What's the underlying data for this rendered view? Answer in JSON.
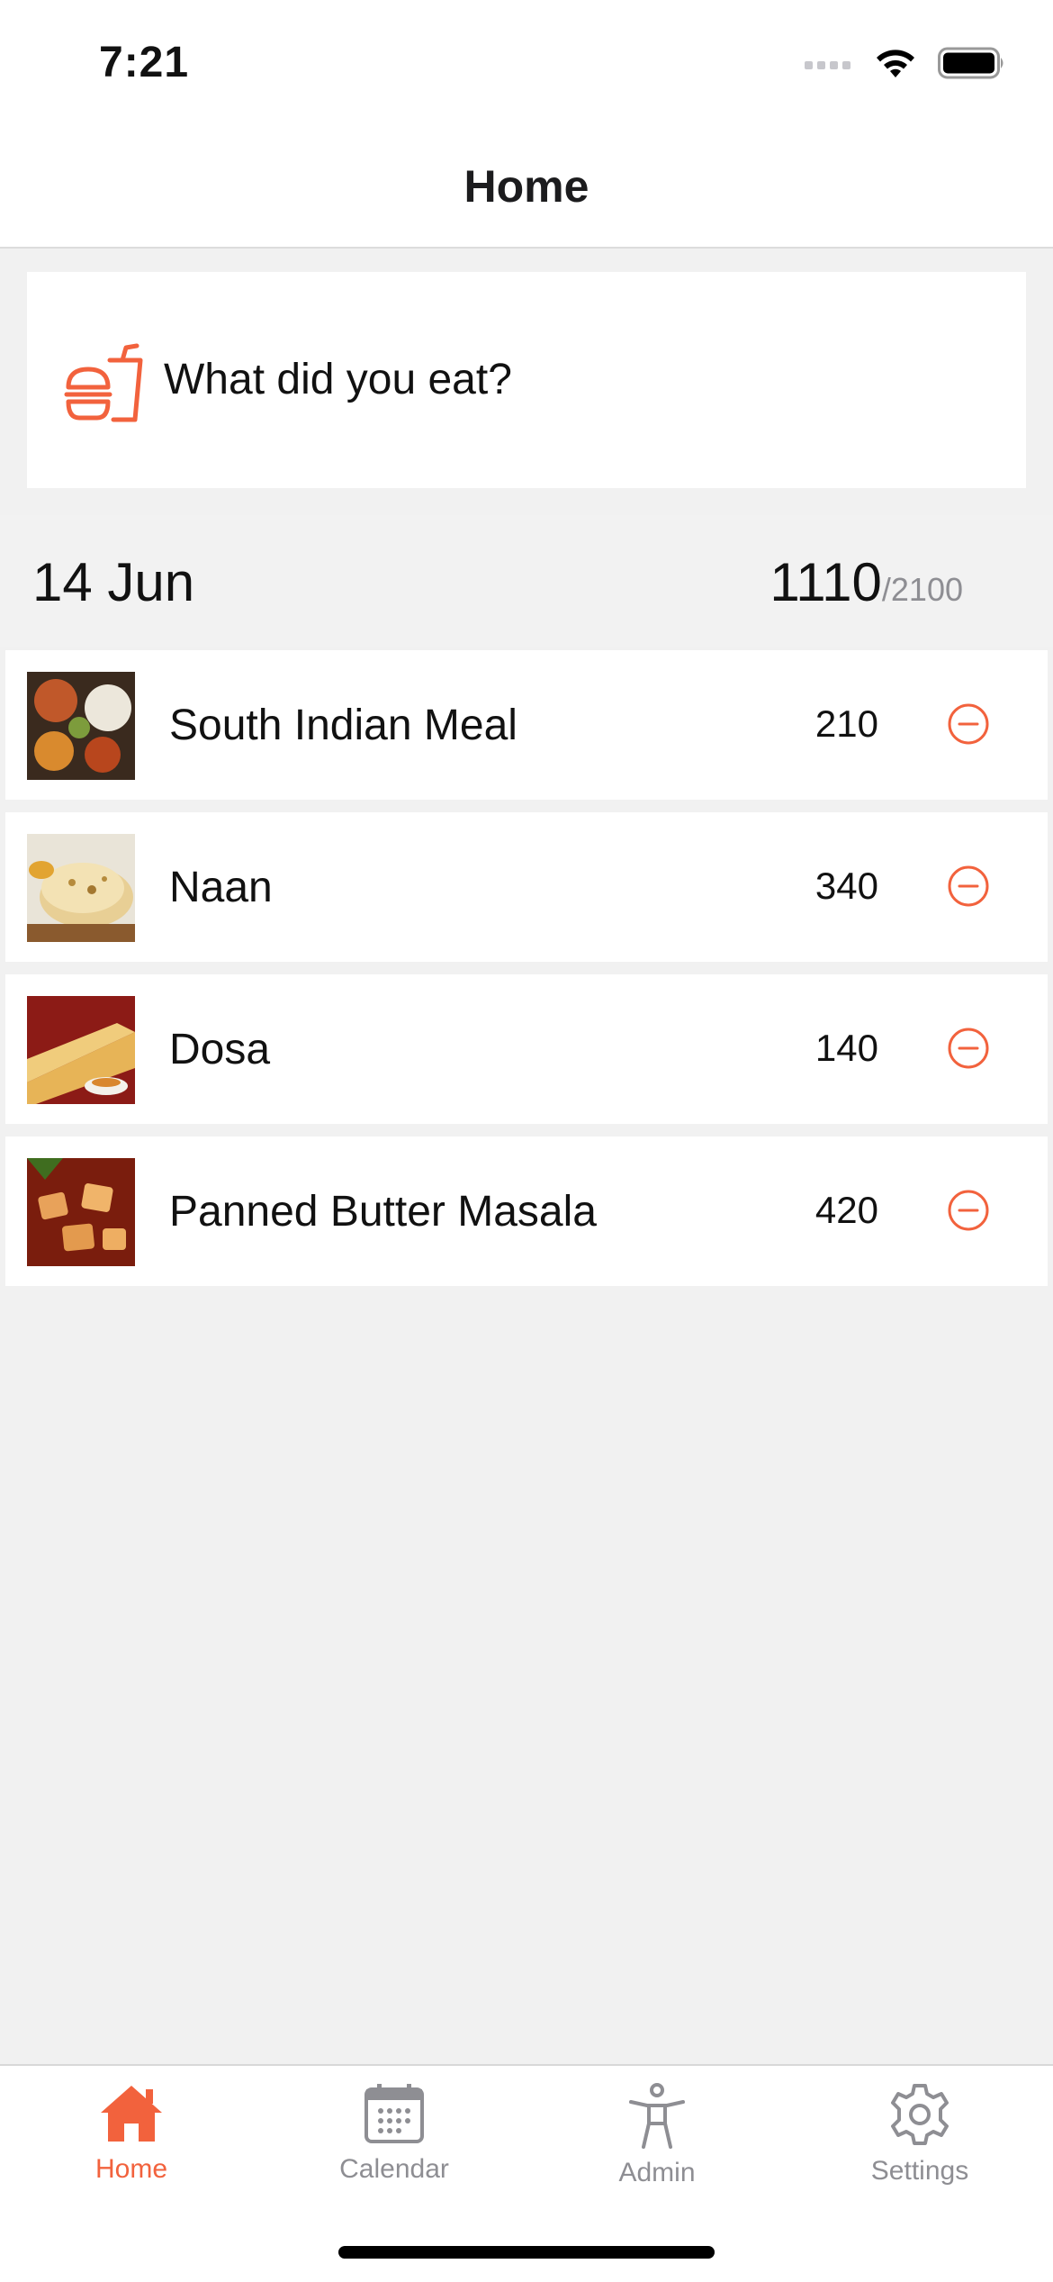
{
  "status_bar": {
    "time": "7:21"
  },
  "header": {
    "title": "Home"
  },
  "prompt": {
    "text": "What did you eat?",
    "icon": "burger-drink-icon"
  },
  "summary": {
    "date": "14 Jun",
    "total": "1110",
    "goal": "/2100"
  },
  "foods": [
    {
      "name": "South Indian Meal",
      "calories": "210",
      "thumb": "meal-thumbnail"
    },
    {
      "name": "Naan",
      "calories": "340",
      "thumb": "naan-thumbnail"
    },
    {
      "name": "Dosa",
      "calories": "140",
      "thumb": "dosa-thumbnail"
    },
    {
      "name": "Panned Butter Masala",
      "calories": "420",
      "thumb": "masala-thumbnail"
    }
  ],
  "tabs": [
    {
      "label": "Home",
      "icon": "home-icon",
      "active": true
    },
    {
      "label": "Calendar",
      "icon": "calendar-icon",
      "active": false
    },
    {
      "label": "Admin",
      "icon": "person-icon",
      "active": false
    },
    {
      "label": "Settings",
      "icon": "gear-icon",
      "active": false
    }
  ],
  "colors": {
    "accent": "#f2623d",
    "background": "#f1f1f1",
    "card": "#ffffff",
    "inactive": "#8e8e93"
  }
}
